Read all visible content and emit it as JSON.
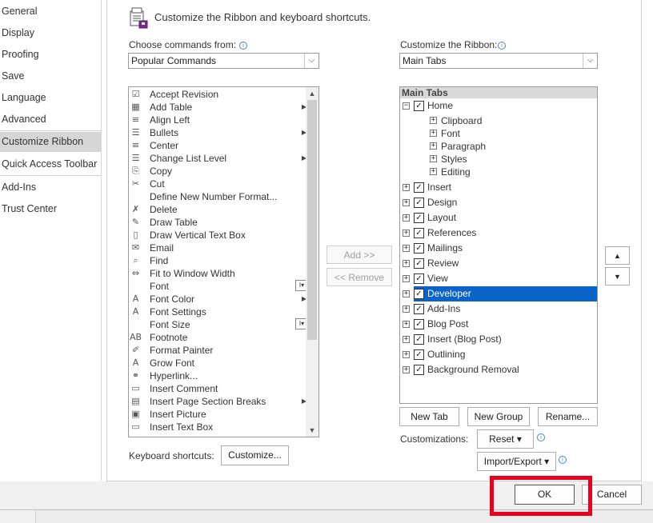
{
  "nav": {
    "items": [
      {
        "label": "General"
      },
      {
        "label": "Display"
      },
      {
        "label": "Proofing"
      },
      {
        "label": "Save"
      },
      {
        "label": "Language"
      },
      {
        "label": "Advanced"
      },
      {
        "label": "Customize Ribbon"
      },
      {
        "label": "Quick Access Toolbar"
      },
      {
        "label": "Add-Ins"
      },
      {
        "label": "Trust Center"
      }
    ],
    "selected": "Customize Ribbon"
  },
  "header": {
    "title": "Customize the Ribbon and keyboard shortcuts."
  },
  "left_pane": {
    "label": "Choose commands from:",
    "combo_value": "Popular Commands",
    "commands": [
      {
        "label": "Accept Revision",
        "icon": "accept-revision-icon",
        "glyph": "☑"
      },
      {
        "label": "Add Table",
        "icon": "table-icon",
        "glyph": "▦",
        "submenu": true
      },
      {
        "label": "Align Left",
        "icon": "align-left-icon",
        "glyph": "≡"
      },
      {
        "label": "Bullets",
        "icon": "bullets-icon",
        "glyph": "☰",
        "submenu": true
      },
      {
        "label": "Center",
        "icon": "center-icon",
        "glyph": "≡"
      },
      {
        "label": "Change List Level",
        "icon": "list-level-icon",
        "glyph": "☰",
        "submenu": true
      },
      {
        "label": "Copy",
        "icon": "copy-icon",
        "glyph": "⎘"
      },
      {
        "label": "Cut",
        "icon": "scissors-icon",
        "glyph": "✂"
      },
      {
        "label": "Define New Number Format...",
        "icon": "",
        "glyph": ""
      },
      {
        "label": "Delete",
        "icon": "delete-icon",
        "glyph": "✗"
      },
      {
        "label": "Draw Table",
        "icon": "draw-table-icon",
        "glyph": "✎"
      },
      {
        "label": "Draw Vertical Text Box",
        "icon": "vertical-textbox-icon",
        "glyph": "▯"
      },
      {
        "label": "Email",
        "icon": "email-icon",
        "glyph": "✉"
      },
      {
        "label": "Find",
        "icon": "find-icon",
        "glyph": "⌕"
      },
      {
        "label": "Fit to Window Width",
        "icon": "fit-width-icon",
        "glyph": "⇔"
      },
      {
        "label": "Font",
        "icon": "",
        "glyph": "",
        "combo": true
      },
      {
        "label": "Font Color",
        "icon": "font-color-icon",
        "glyph": "A",
        "submenu": true
      },
      {
        "label": "Font Settings",
        "icon": "font-settings-icon",
        "glyph": "A"
      },
      {
        "label": "Font Size",
        "icon": "",
        "glyph": "",
        "combo": true
      },
      {
        "label": "Footnote",
        "icon": "footnote-icon",
        "glyph": "AB"
      },
      {
        "label": "Format Painter",
        "icon": "format-painter-icon",
        "glyph": "✐"
      },
      {
        "label": "Grow Font",
        "icon": "grow-font-icon",
        "glyph": "A"
      },
      {
        "label": "Hyperlink...",
        "icon": "hyperlink-icon",
        "glyph": "⚭"
      },
      {
        "label": "Insert Comment",
        "icon": "comment-icon",
        "glyph": "▭"
      },
      {
        "label": "Insert Page  Section Breaks",
        "icon": "page-break-icon",
        "glyph": "▤",
        "submenu": true
      },
      {
        "label": "Insert Picture",
        "icon": "picture-icon",
        "glyph": "▣"
      },
      {
        "label": "Insert Text Box",
        "icon": "textbox-icon",
        "glyph": "▭"
      }
    ],
    "keyboard_label": "Keyboard shortcuts:",
    "customize_button": "Customize..."
  },
  "middle": {
    "add_button": "Add >>",
    "remove_button": "<< Remove"
  },
  "right_pane": {
    "label": "Customize the Ribbon:",
    "combo_value": "Main Tabs",
    "tree_header": "Main Tabs",
    "tabs": [
      {
        "label": "Home",
        "checked": true,
        "expanded": true,
        "groups": [
          "Clipboard",
          "Font",
          "Paragraph",
          "Styles",
          "Editing"
        ]
      },
      {
        "label": "Insert",
        "checked": true
      },
      {
        "label": "Design",
        "checked": true
      },
      {
        "label": "Layout",
        "checked": true
      },
      {
        "label": "References",
        "checked": true
      },
      {
        "label": "Mailings",
        "checked": true
      },
      {
        "label": "Review",
        "checked": true
      },
      {
        "label": "View",
        "checked": true
      },
      {
        "label": "Developer",
        "checked": true,
        "selected": true
      },
      {
        "label": "Add-Ins",
        "checked": true
      },
      {
        "label": "Blog Post",
        "checked": true
      },
      {
        "label": "Insert (Blog Post)",
        "checked": true
      },
      {
        "label": "Outlining",
        "checked": true
      },
      {
        "label": "Background Removal",
        "checked": true
      }
    ],
    "new_tab_button": "New Tab",
    "new_group_button": "New Group",
    "rename_button": "Rename...",
    "customizations_label": "Customizations:",
    "reset_button": "Reset ▾",
    "import_export_button": "Import/Export ▾",
    "move_up": "▲",
    "move_down": "▼"
  },
  "footer": {
    "ok_button": "OK",
    "cancel_button": "Cancel"
  },
  "colors": {
    "selection": "#0a64c8",
    "highlight": "#e8001c",
    "nav_selected": "#d6d6d6"
  }
}
